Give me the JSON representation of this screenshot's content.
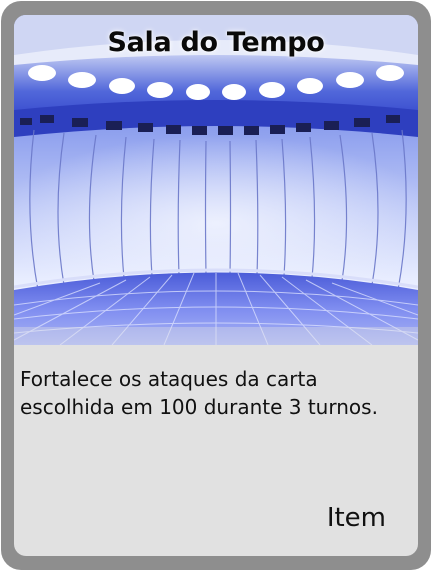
{
  "card": {
    "title": "Sala do Tempo",
    "description": "Fortalece os ataques da carta escolhida em 100 durante 3 turnos.",
    "type": "Item",
    "art_icon": "room-of-time-illustration"
  },
  "colors": {
    "frame": "#8e8e8e",
    "panel": "#e1e1e1",
    "art_blue": "#3d52d8",
    "art_light": "#eef2ff"
  }
}
